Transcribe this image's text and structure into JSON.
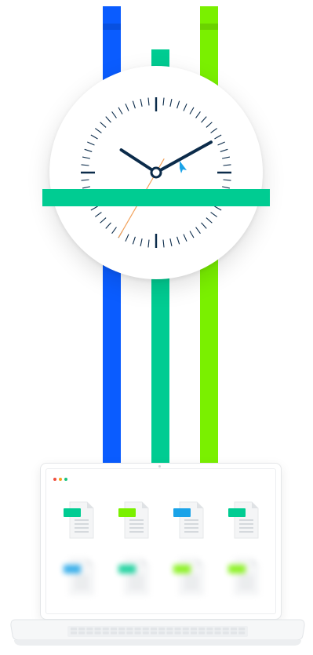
{
  "colors": {
    "blue": "#0a5cff",
    "teal": "#00cc92",
    "lime": "#7af000",
    "hand": "#0b2b4a",
    "second_hand": "#f2a25c",
    "cursor": "#1aa3e8",
    "window_dot_red": "#f04e3e",
    "window_dot_orange": "#f7a21b",
    "window_dot_green": "#19c37d",
    "file_paper": "#f4f5f6",
    "file_lines": "#d5d9dd"
  },
  "clock": {
    "hour_hand": "hour-hand",
    "minute_hand": "minute-hand",
    "second_hand": "second-hand",
    "cursor_icon": "cursor-arrow-icon"
  },
  "files_top_row": [
    {
      "label_color": "#00cc92",
      "icon": "document-icon"
    },
    {
      "label_color": "#7af000",
      "icon": "document-icon"
    },
    {
      "label_color": "#1aa3e8",
      "icon": "document-icon"
    },
    {
      "label_color": "#00cc92",
      "icon": "document-icon"
    }
  ],
  "files_bottom_row": [
    {
      "label_color": "#1aa3e8",
      "icon": "document-icon"
    },
    {
      "label_color": "#00cc92",
      "icon": "document-icon"
    },
    {
      "label_color": "#7af000",
      "icon": "document-icon"
    },
    {
      "label_color": "#7af000",
      "icon": "document-icon"
    }
  ]
}
